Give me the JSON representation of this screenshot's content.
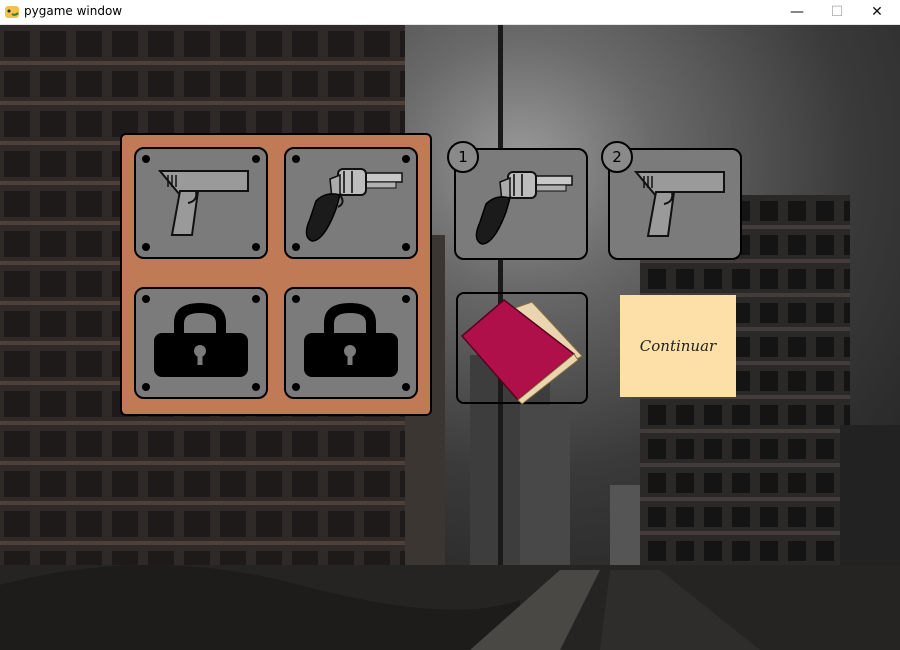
{
  "window": {
    "title": "pygame window",
    "controls": {
      "minimize": "—",
      "maximize": "☐",
      "close": "✕"
    }
  },
  "colors": {
    "panel": "#c07b56",
    "slot": "#7b7b7b",
    "continue_bg": "#fde0a8",
    "book": "#b0104a"
  },
  "inventory": {
    "slots": [
      {
        "icon": "pistol-icon",
        "locked": false
      },
      {
        "icon": "revolver-icon",
        "locked": false
      },
      {
        "icon": "lock-icon",
        "locked": true
      },
      {
        "icon": "lock-icon",
        "locked": true
      }
    ]
  },
  "equipped": [
    {
      "number": "1",
      "icon": "revolver-icon"
    },
    {
      "number": "2",
      "icon": "pistol-icon"
    }
  ],
  "book": {
    "icon": "book-icon"
  },
  "continue_button": {
    "label": "Continuar"
  }
}
